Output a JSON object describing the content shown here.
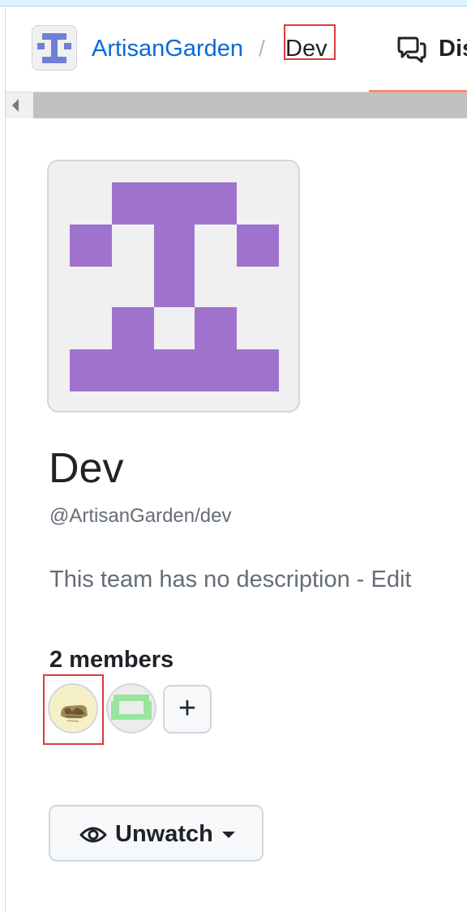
{
  "header": {
    "org_name": "ArtisanGarden",
    "separator": "/",
    "team_crumb": "Dev",
    "tab_label": "Dis",
    "tab_icon": "comment-discussion-icon"
  },
  "team": {
    "name": "Dev",
    "slug": "@ArtisanGarden/dev",
    "description": "This team has no description - ",
    "edit_link": "Edit",
    "avatar_color": "#9f73cd"
  },
  "members": {
    "count_label": "2 members",
    "add_label": "+",
    "avatars": [
      {
        "icon": "user-avatar-photo"
      },
      {
        "icon": "user-avatar-identicon",
        "color": "#99e5a0"
      }
    ]
  },
  "watch": {
    "label": "Unwatch",
    "icon": "eye-icon",
    "caret": "triangle-down-icon"
  },
  "colors": {
    "link": "#0969da",
    "text": "#1f2328",
    "muted": "#656d76",
    "tab_underline": "#fd8c73",
    "highlight_box": "#e03a3a"
  }
}
